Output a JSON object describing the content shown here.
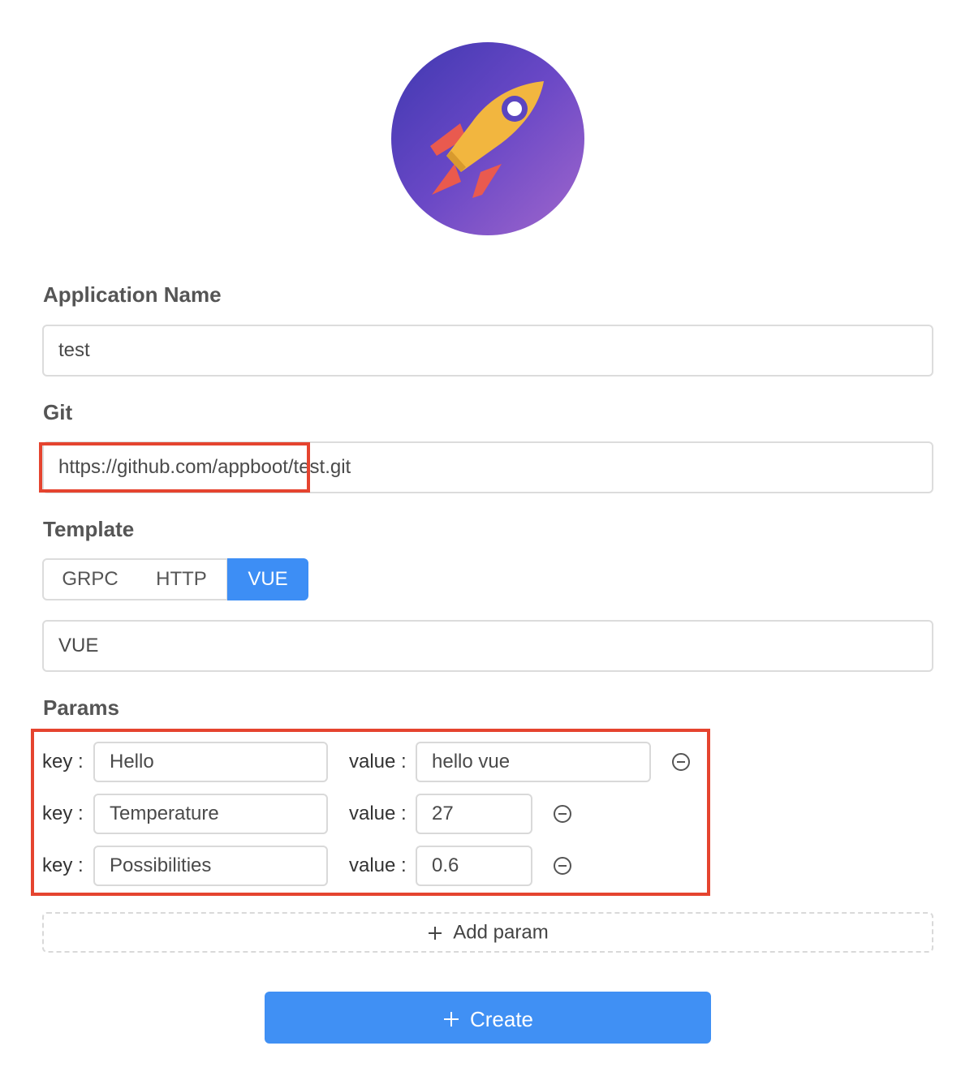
{
  "logo": {
    "icon": "rocket-icon"
  },
  "app_name": {
    "label": "Application Name",
    "value": "test"
  },
  "git": {
    "label": "Git",
    "value": "https://github.com/appboot/test.git"
  },
  "template": {
    "label": "Template",
    "options": [
      "GRPC",
      "HTTP",
      "VUE"
    ],
    "selected": "VUE",
    "value": "VUE"
  },
  "params": {
    "label": "Params",
    "key_label": "key",
    "value_label": "value",
    "rows": [
      {
        "key": "Hello",
        "value": "hello vue"
      },
      {
        "key": "Temperature",
        "value": "27"
      },
      {
        "key": "Possibilities",
        "value": "0.6"
      }
    ],
    "add_label": "Add param"
  },
  "create_label": "Create",
  "colors": {
    "accent": "#4090f4",
    "highlight": "#e5442f"
  }
}
